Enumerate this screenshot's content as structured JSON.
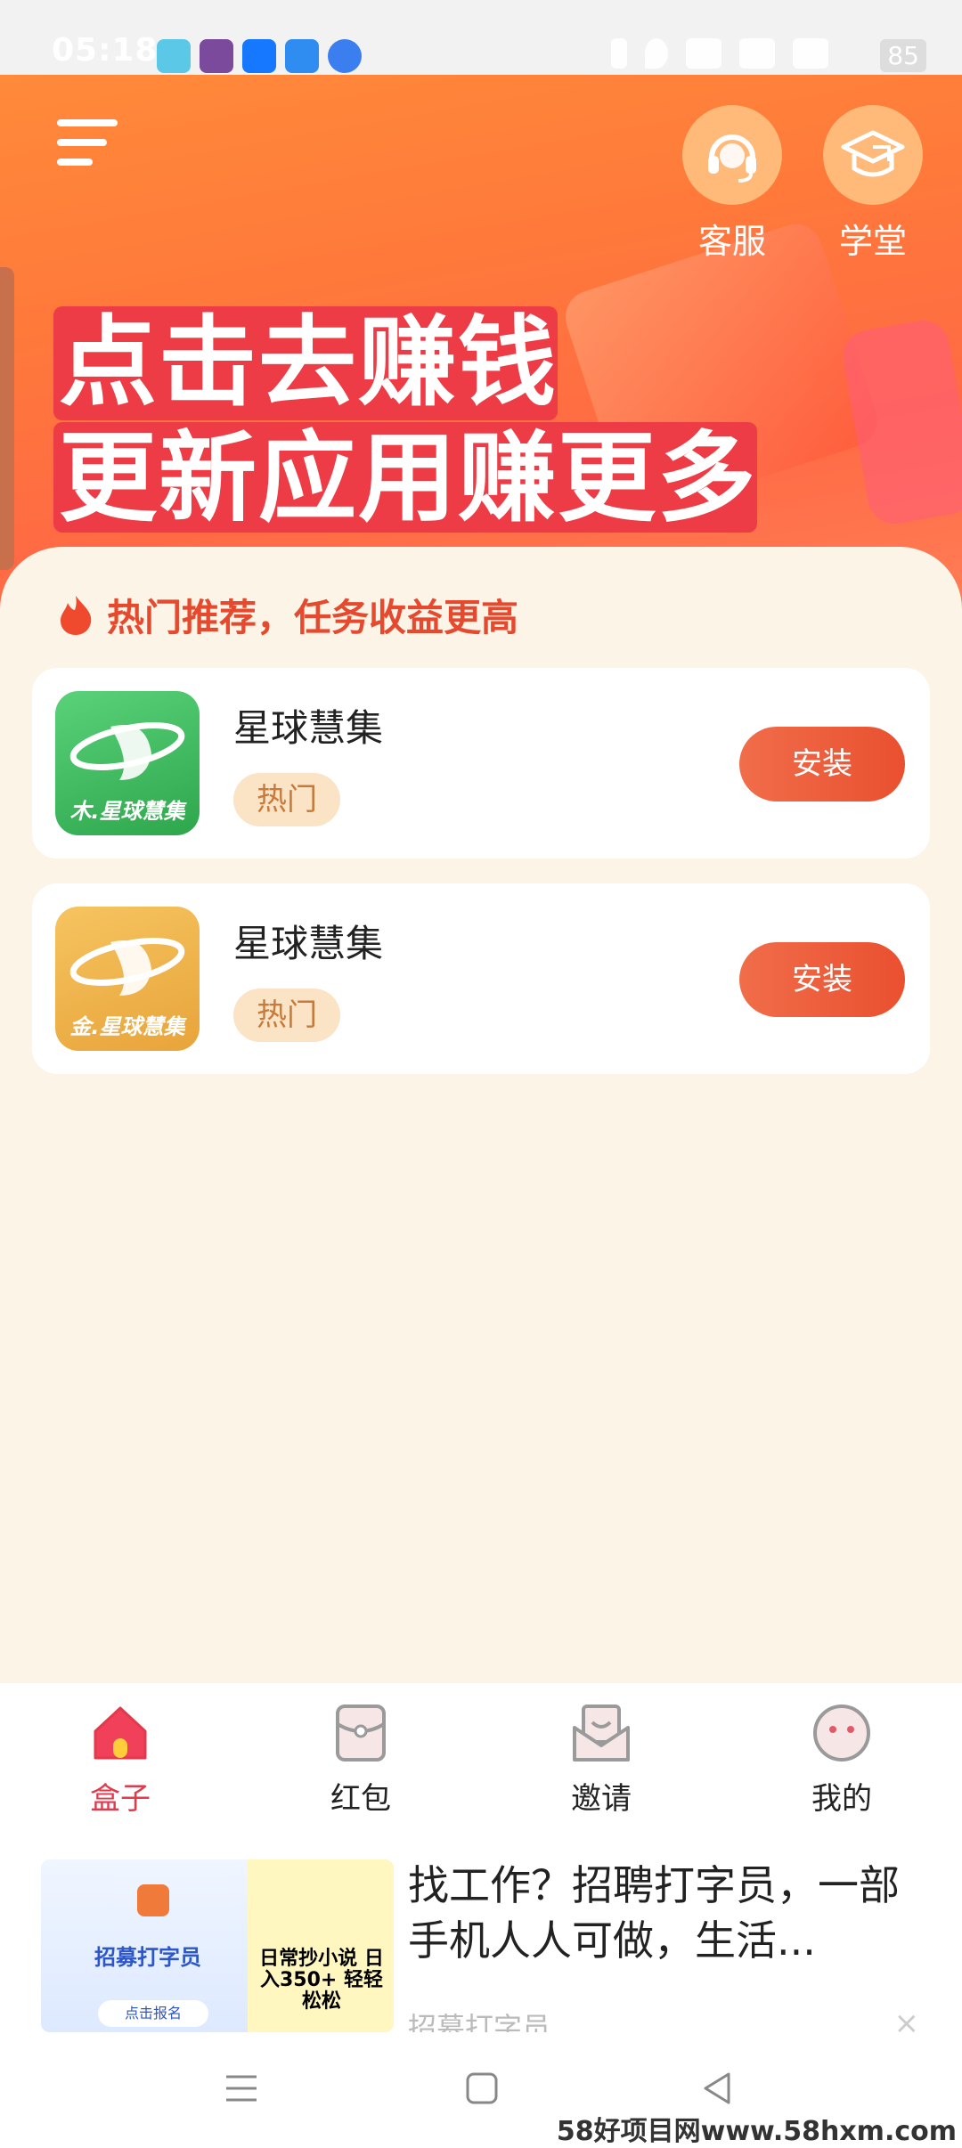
{
  "status_bar": {
    "time": "05:18",
    "battery": "85"
  },
  "header": {
    "service_label": "客服",
    "academy_label": "学堂",
    "headline_line1": "点击去赚钱",
    "headline_line2": "更新应用赚更多"
  },
  "recommend": {
    "title": "热门推荐，任务收益更高",
    "apps": [
      {
        "name": "星球慧集",
        "tag": "热门",
        "button": "安装",
        "icon_label": "木.星球慧集",
        "icon_color": "#3cb85a"
      },
      {
        "name": "星球慧集",
        "tag": "热门",
        "button": "安装",
        "icon_label": "金.星球慧集",
        "icon_color": "#efb54a"
      }
    ]
  },
  "tabs": [
    {
      "label": "盒子",
      "icon": "home-icon",
      "active": true
    },
    {
      "label": "红包",
      "icon": "red-packet-icon",
      "active": false
    },
    {
      "label": "邀请",
      "icon": "invite-icon",
      "active": false
    },
    {
      "label": "我的",
      "icon": "profile-icon",
      "active": false
    }
  ],
  "ad": {
    "title": "找工作？招聘打字员，一部手机人人可做，生活...",
    "source": "招募打字员",
    "close": "×",
    "thumb_recruit": "招募打字员",
    "thumb_signup": "点击报名",
    "thumb_novel": "日常抄小说 日入350+ 轻轻松松"
  },
  "watermark": "58好项目网www.58hxm.com",
  "colors": {
    "accent": "#e9502f",
    "banner": "#ff7a3a",
    "tab_active": "#e23a4c",
    "background": "#fdf4e8"
  }
}
